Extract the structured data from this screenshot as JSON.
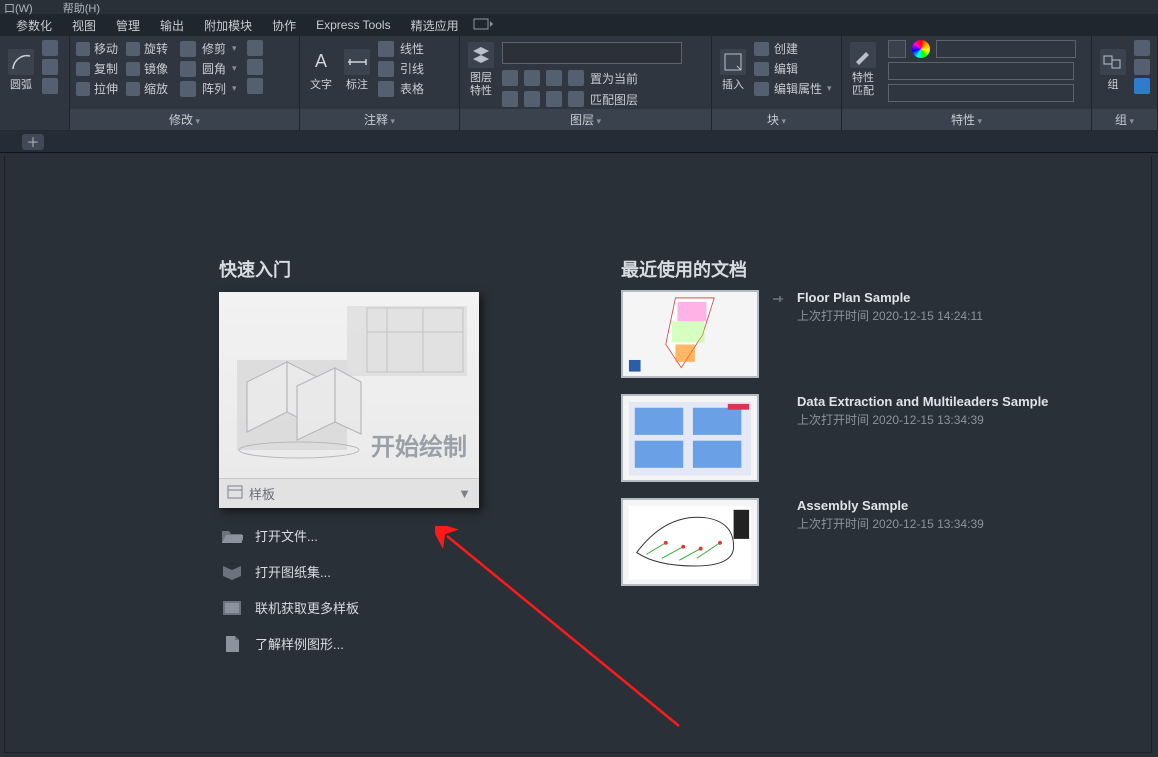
{
  "top_menu": {
    "window": "口(W)",
    "help": "帮助(H)"
  },
  "menu": {
    "items": [
      "参数化",
      "视图",
      "管理",
      "输出",
      "附加模块",
      "协作",
      "Express Tools",
      "精选应用"
    ]
  },
  "ribbon": {
    "arc": {
      "label": "圆弧"
    },
    "modify": {
      "label": "修改",
      "move": "移动",
      "rotate": "旋转",
      "trim": "修剪",
      "copy": "复制",
      "mirror": "镜像",
      "fillet": "圆角",
      "stretch": "拉伸",
      "scale": "缩放",
      "array": "阵列"
    },
    "annotate": {
      "label": "注释",
      "text": "文字",
      "dimension": "标注",
      "line": "线性",
      "leader": "引线",
      "table": "表格"
    },
    "layer": {
      "label": "图层",
      "props": "图层\n特性",
      "set_current": "置为当前",
      "match": "匹配图层",
      "combo": ""
    },
    "block": {
      "label": "块",
      "insert": "插入",
      "create": "创建",
      "edit": "编辑",
      "edit_attr": "编辑属性"
    },
    "properties": {
      "label": "特性",
      "match": "特性\n匹配"
    },
    "group": {
      "label": "组",
      "group": "组"
    }
  },
  "start": {
    "quick_start": "快速入门",
    "start_drawing": "开始绘制",
    "template": "样板",
    "open_file": "打开文件...",
    "open_sheetset": "打开图纸集...",
    "more_templates": "联机获取更多样板",
    "learn_samples": "了解样例图形..."
  },
  "recent": {
    "title": "最近使用的文档",
    "last_opened": "上次打开时间",
    "items": [
      {
        "name": "Floor Plan Sample",
        "time": "2020-12-15 14:24:11"
      },
      {
        "name": "Data Extraction and Multileaders Sample",
        "time": "2020-12-15 13:34:39"
      },
      {
        "name": "Assembly Sample",
        "time": "2020-12-15 13:34:39"
      }
    ]
  }
}
